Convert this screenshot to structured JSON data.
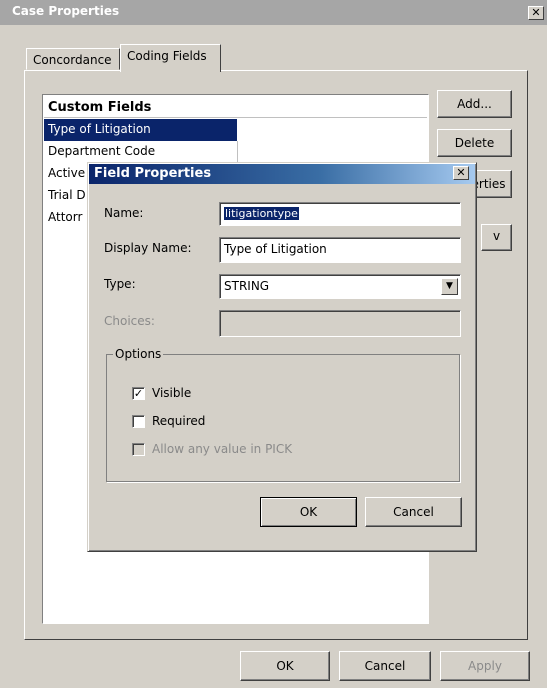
{
  "main_window": {
    "title": "Case Properties",
    "close_glyph": "✕",
    "tabs": [
      {
        "label": "Concordance"
      },
      {
        "label": "Coding Fields"
      }
    ],
    "list": {
      "header": "Custom Fields",
      "items": [
        {
          "label": "Type of Litigation",
          "selected": true
        },
        {
          "label": "Department Code"
        },
        {
          "label": "Active"
        },
        {
          "label": "Trial D"
        },
        {
          "label": "Attorr"
        }
      ]
    },
    "side_buttons": {
      "add": "Add...",
      "delete": "Delete",
      "properties": "erties",
      "move": "v"
    },
    "footer_buttons": {
      "ok": "OK",
      "cancel": "Cancel",
      "apply": "Apply"
    }
  },
  "dialog": {
    "title": "Field Properties",
    "close_glyph": "✕",
    "fields": {
      "name_label": "Name:",
      "name_value": "litigationtype",
      "display_name_label": "Display Name:",
      "display_name_value": "Type of Litigation",
      "type_label": "Type:",
      "type_value": "STRING",
      "choices_label": "Choices:",
      "choices_value": ""
    },
    "options": {
      "legend": "Options",
      "visible_label": "Visible",
      "visible_checked": true,
      "required_label": "Required",
      "required_checked": false,
      "allow_any_label": "Allow any value in PICK",
      "allow_any_checked": false
    },
    "buttons": {
      "ok": "OK",
      "cancel": "Cancel"
    }
  },
  "colors": {
    "selection": "#0a246a",
    "window_face": "#d4d0c8"
  }
}
